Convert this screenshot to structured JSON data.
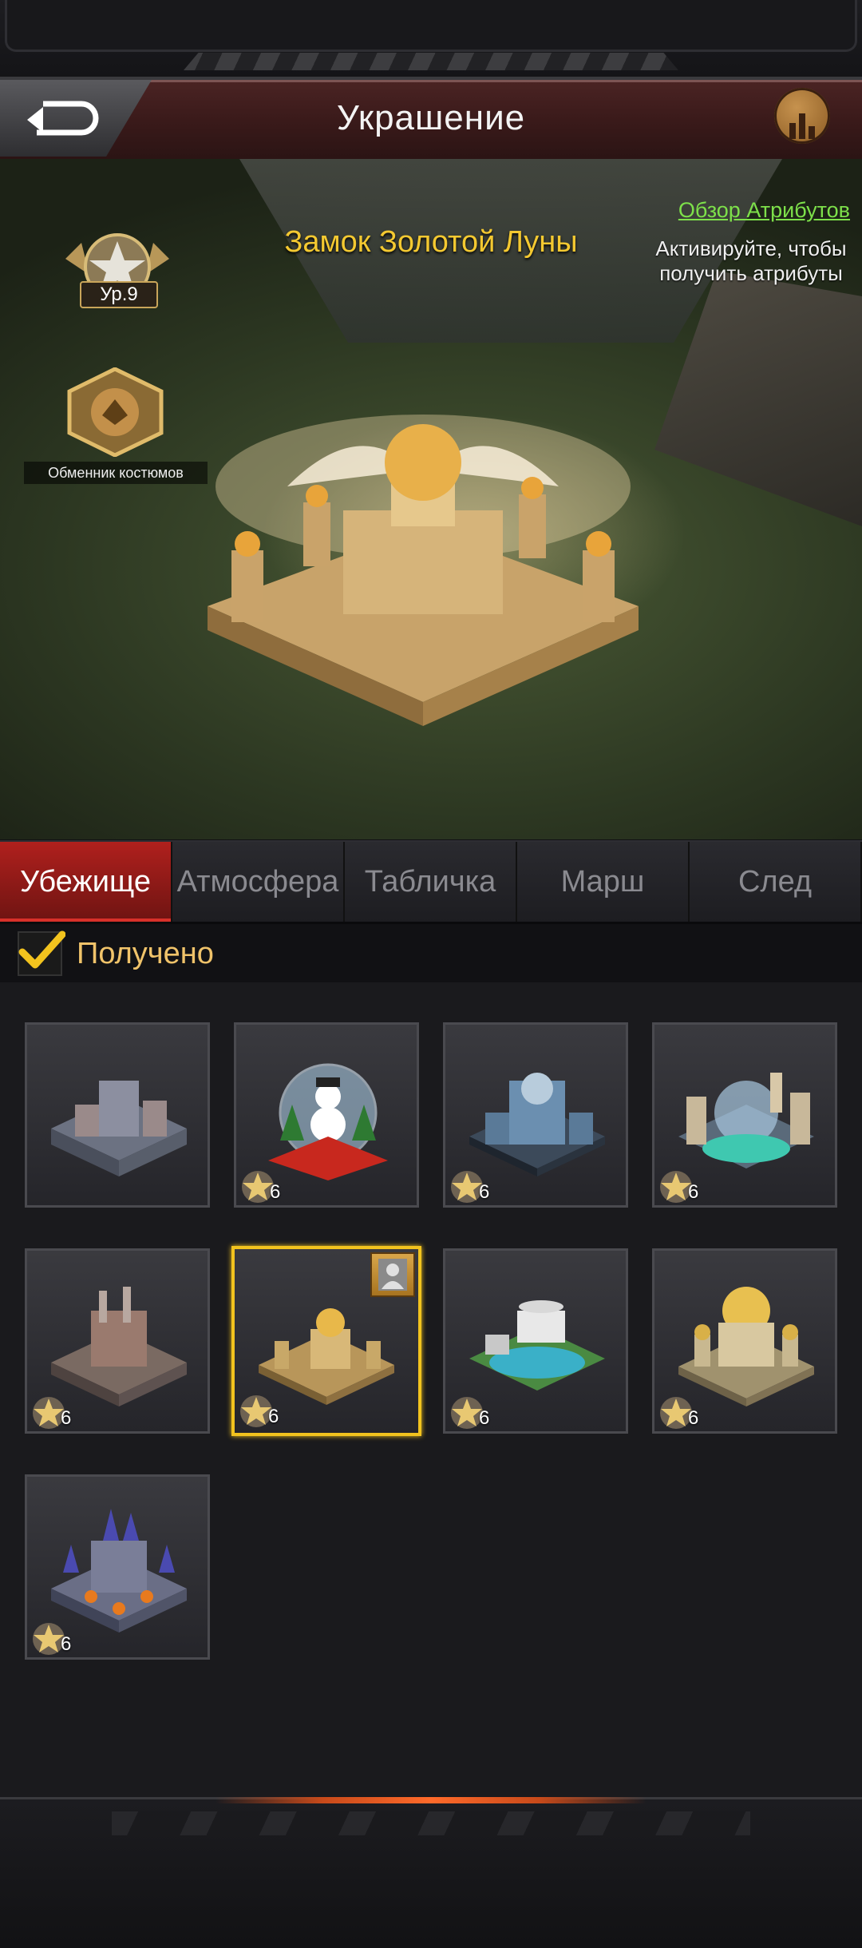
{
  "header": {
    "title": "Украшение"
  },
  "hero": {
    "castle_name": "Замок Золотой Луны",
    "level_badge": "Ур.9",
    "exchanger_label": "Обменник костюмов",
    "attributes_link": "Обзор Атрибутов",
    "activate_hint": "Активируйте, чтобы получить атрибуты"
  },
  "tabs": [
    {
      "label": "Убежище",
      "active": true
    },
    {
      "label": "Атмосфера",
      "active": false
    },
    {
      "label": "Табличка",
      "active": false
    },
    {
      "label": "Марш",
      "active": false
    },
    {
      "label": "След",
      "active": false
    }
  ],
  "filter": {
    "label": "Получено",
    "checked": true
  },
  "items": [
    {
      "name": "grey-fortress",
      "stars": "",
      "selected": false
    },
    {
      "name": "snow-globe",
      "stars": "6",
      "selected": false
    },
    {
      "name": "blue-city",
      "stars": "6",
      "selected": false
    },
    {
      "name": "dome-city",
      "stars": "6",
      "selected": false
    },
    {
      "name": "industrial-base",
      "stars": "6",
      "selected": false
    },
    {
      "name": "golden-moon-castle",
      "stars": "6",
      "selected": true
    },
    {
      "name": "resort-base",
      "stars": "6",
      "selected": false
    },
    {
      "name": "golden-palace",
      "stars": "6",
      "selected": false
    },
    {
      "name": "halloween-castle",
      "stars": "6",
      "selected": false
    }
  ],
  "colors": {
    "accent": "#f2c31e",
    "tab_active": "#b0201d",
    "link": "#7de04a",
    "title_gold": "#f4c931"
  }
}
